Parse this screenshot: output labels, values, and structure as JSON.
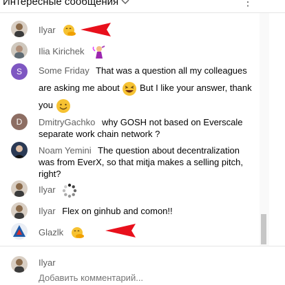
{
  "header": {
    "title": "Интересные сообщения",
    "menu": "⋮"
  },
  "messages": [
    {
      "author": "Ilyar",
      "text": "",
      "emoji": "face-with-hand-over-mouth",
      "avatar_color": "#8a6a4a"
    },
    {
      "author": "Ilia Kirichek",
      "text": "",
      "emoji": "fairy",
      "avatar_color": "#b0a090"
    },
    {
      "author": "Some Friday",
      "text": "That was a question all my colleagues are asking me about",
      "text2": "But I like your answer, thank you",
      "emoji": "grinning-squinting-face",
      "emoji2": "smiling-face",
      "avatar_letter": "S",
      "avatar_color": "#7e57c2"
    },
    {
      "author": "DmitryGachko",
      "text": "why GOSH not based on Everscale separate work chain network ?",
      "avatar_letter": "D",
      "avatar_color": "#8d6e63"
    },
    {
      "author": "Noam Yemini",
      "text": "The question about decentralization was from EverX, so that mitja makes a selling pitch, right?",
      "avatar_color": "#2b3a55"
    },
    {
      "author": "Ilyar",
      "text": "",
      "emoji": "loading-spinner",
      "avatar_color": "#8a6a4a"
    },
    {
      "author": "Ilyar",
      "text": "Flex on ginhub and comon!!",
      "avatar_color": "#8a6a4a"
    },
    {
      "author": "Glazlk",
      "text": "",
      "emoji": "face-with-hand-over-mouth",
      "avatar_color": "#1e5aa8"
    }
  ],
  "compose": {
    "name": "Ilyar",
    "placeholder": "Добавить комментарий..."
  },
  "colors": {
    "annotation_arrow": "#e8101c",
    "author": "#606060"
  }
}
